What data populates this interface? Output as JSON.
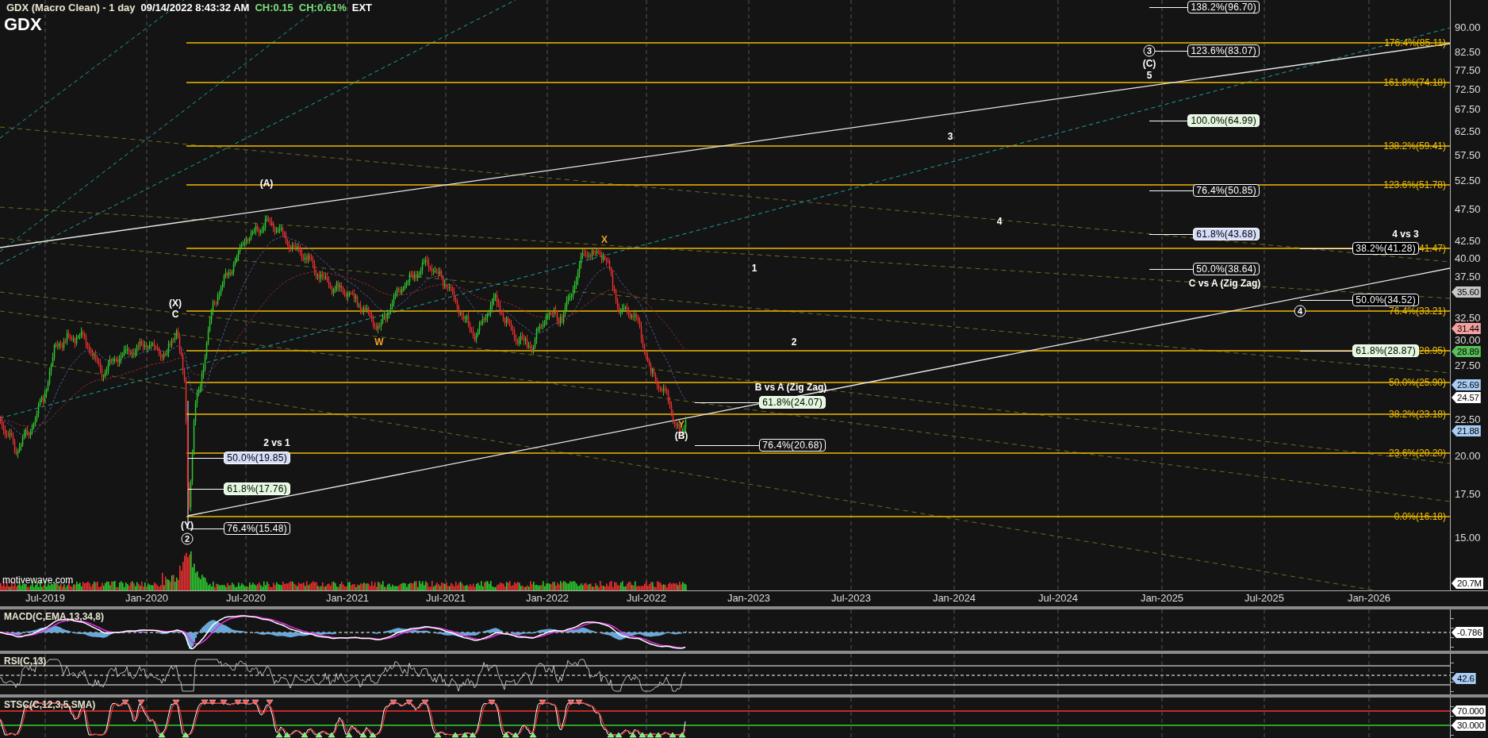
{
  "header": {
    "title": "GDX (Macro Clean) - 1 day",
    "timestamp": "09/14/2022 8:43:32 AM",
    "change": "CH:0.15",
    "change_percent": "CH:0.61%",
    "session": "EXT"
  },
  "symbol": "GDX",
  "price_pane": {
    "price_axis": [
      "90.00",
      "82.50",
      "77.50",
      "72.50",
      "67.50",
      "62.50",
      "57.50",
      "52.50",
      "47.50",
      "42.50",
      "40.00",
      "37.50",
      "32.50",
      "30.00",
      "27.50",
      "22.50",
      "20.00",
      "17.50",
      "15.00"
    ],
    "level_lines": [
      {
        "label": "176.4%(85.11)"
      },
      {
        "label": "161.8%(74.18)"
      },
      {
        "label": "138.2%(59.41)"
      },
      {
        "label": "123.6%(51.78)"
      },
      {
        "label": "41.47)"
      },
      {
        "label": "76.4%(33.21)"
      },
      {
        "label": "28.95)"
      },
      {
        "label": "50.0%(25.90)"
      },
      {
        "label": "38.2%(23.18)"
      },
      {
        "label": "23.6%(20.20)"
      },
      {
        "label": "0.0%(16.18)"
      }
    ],
    "projection_labels": [
      {
        "label": "138.2%(96.70)",
        "color": "#141414"
      },
      {
        "label": "123.6%(83.07)",
        "color": "#141414"
      },
      {
        "label": "100.0%(64.99)",
        "color": "#e2f8dc"
      },
      {
        "label": "76.4%(50.85)",
        "color": "#141414"
      },
      {
        "label": "61.8%(43.68)",
        "color": "#d4dcf8"
      },
      {
        "label": "50.0%(38.64)",
        "color": "#141414"
      },
      {
        "label": "38.2%(41.28)",
        "color": "#000000"
      },
      {
        "label": "50.0%(34.52)",
        "color": "#000000"
      },
      {
        "label": "61.8%(28.87)",
        "color": "#e2f8dc"
      },
      {
        "label": "61.8%(24.07)",
        "color": "#e2f8dc"
      },
      {
        "label": "76.4%(20.68)",
        "color": "#141414"
      },
      {
        "label": "50.0%(19.85)",
        "color": "#d4dcf8"
      },
      {
        "label": "61.8%(17.76)",
        "color": "#e2f8dc"
      },
      {
        "label": "76.4%(15.48)",
        "color": "#141414"
      }
    ],
    "wave_labels": [
      {
        "text": "(A)",
        "kind": "plain",
        "color": "#ffffff"
      },
      {
        "text": "(X)",
        "kind": "plain",
        "color": "#ffffff"
      },
      {
        "text": "C",
        "kind": "plain",
        "color": "#ffffff"
      },
      {
        "text": "W",
        "kind": "plain",
        "color": "#f0a028"
      },
      {
        "text": "X",
        "kind": "plain",
        "color": "#f0a028"
      },
      {
        "text": "Y",
        "kind": "plain",
        "color": "#f0a028"
      },
      {
        "text": "(B)",
        "kind": "plain",
        "color": "#ffffff"
      },
      {
        "text": "(Y)",
        "kind": "plain",
        "color": "#ffffff"
      },
      {
        "text": "2",
        "kind": "circled",
        "color": "#ffffff"
      },
      {
        "text": "1",
        "kind": "plain",
        "color": "#ffffff"
      },
      {
        "text": "2",
        "kind": "plain",
        "color": "#ffffff"
      },
      {
        "text": "3",
        "kind": "plain",
        "color": "#ffffff"
      },
      {
        "text": "4",
        "kind": "plain",
        "color": "#ffffff"
      },
      {
        "text": "3",
        "kind": "circled",
        "color": "#ffffff"
      },
      {
        "text": "(C)",
        "kind": "plain",
        "color": "#ffffff"
      },
      {
        "text": "5",
        "kind": "plain",
        "color": "#ffffff"
      },
      {
        "text": "4",
        "kind": "circled",
        "color": "#ffffff"
      }
    ],
    "notes": [
      "2 vs 1",
      "B vs A (Zig Zag)",
      "C vs A (Zig Zag)",
      "4 vs 3"
    ],
    "price_tags": [
      {
        "text": "35.60",
        "color": "#c8c8c8"
      },
      {
        "text": "31.44",
        "color": "#f5a0a0"
      },
      {
        "text": "28.89",
        "color": "#58c058"
      },
      {
        "text": "25.69",
        "color": "#a8cdf5"
      },
      {
        "text": "24.57",
        "color": "#ffffff"
      },
      {
        "text": "21.88",
        "color": "#a8cdf5"
      },
      {
        "text": "20.7M",
        "color": "#ffffff"
      }
    ],
    "source": "motivewave.com"
  },
  "date_axis": [
    "Jul-2019",
    "Jan-2020",
    "Jul-2020",
    "Jan-2021",
    "Jul-2021",
    "Jan-2022",
    "Jul-2022",
    "Jan-2023",
    "Jul-2023",
    "Jan-2024",
    "Jul-2024",
    "Jan-2025",
    "Jul-2025",
    "Jan-2026"
  ],
  "indicators": [
    {
      "kind": "macd",
      "title": "MACD(C,EMA,13,34,8)",
      "tags": [
        {
          "text": "-0.786",
          "color": "#ffffff"
        }
      ]
    },
    {
      "kind": "rsi",
      "title": "RSI(C,13)",
      "tags": [
        {
          "text": "42.6",
          "color": "#a8cdf5"
        }
      ]
    },
    {
      "kind": "stochastic",
      "title": "STSC(C,12,3,5,SMA)",
      "tags": [
        {
          "text": "70.000",
          "color": "#ffffff"
        },
        {
          "text": "30.000",
          "color": "#ffffff"
        }
      ]
    }
  ]
}
